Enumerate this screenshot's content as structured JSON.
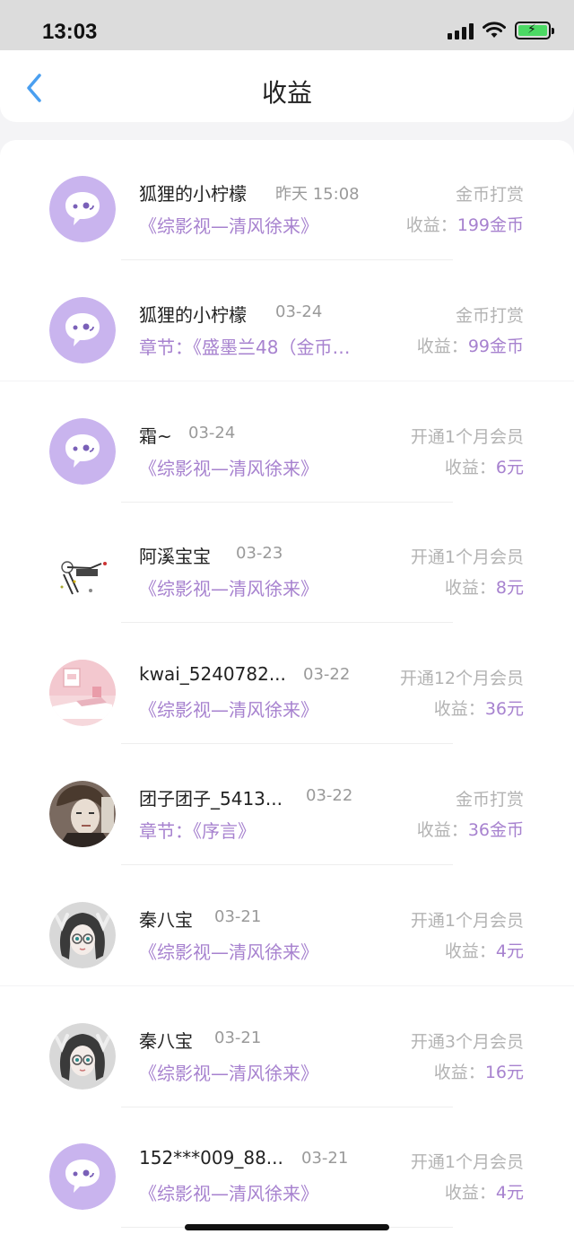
{
  "status": {
    "time": "13:03"
  },
  "nav": {
    "title": "收益"
  },
  "colors": {
    "accent": "#a782cf",
    "avatar_bg": "#c9b4ee",
    "back": "#4a9ff0"
  },
  "entries": [
    {
      "name": "狐狸的小柠檬",
      "date": "昨天 15:08",
      "book": "《综影视—清风徐来》",
      "type": "金币打赏",
      "income_label": "收益：",
      "income_value": "199金币",
      "avatar": "default-chat-avatar"
    },
    {
      "name": "狐狸的小柠檬",
      "date": "03-24",
      "book": "章节：《盛墨兰48（金币…",
      "type": "金币打赏",
      "income_label": "收益：",
      "income_value": "99金币",
      "avatar": "default-chat-avatar"
    },
    {
      "name": "霜~",
      "date": "03-24",
      "book": "《综影视—清风徐来》",
      "type": "开通1个月会员",
      "income_label": "收益：",
      "income_value": "6元",
      "avatar": "default-chat-avatar"
    },
    {
      "name": "阿溪宝宝",
      "date": "03-23",
      "book": "《综影视—清风徐来》",
      "type": "开通1个月会员",
      "income_label": "收益：",
      "income_value": "8元",
      "avatar": "sketch-avatar"
    },
    {
      "name": "kwai_5240782...",
      "date": "03-22",
      "book": "《综影视—清风徐来》",
      "type": "开通12个月会员",
      "income_label": "收益：",
      "income_value": "36元",
      "avatar": "pink-room-avatar"
    },
    {
      "name": "团子团子_5413...",
      "date": "03-22",
      "book": "章节：《序言》",
      "type": "金币打赏",
      "income_label": "收益：",
      "income_value": "36金币",
      "avatar": "portrait-avatar"
    },
    {
      "name": "秦八宝",
      "date": "03-21",
      "book": "《综影视—清风徐来》",
      "type": "开通1个月会员",
      "income_label": "收益：",
      "income_value": "4元",
      "avatar": "anime-girl-avatar"
    },
    {
      "name": "秦八宝",
      "date": "03-21",
      "book": "《综影视—清风徐来》",
      "type": "开通3个月会员",
      "income_label": "收益：",
      "income_value": "16元",
      "avatar": "anime-girl-avatar"
    },
    {
      "name": "152***009_88...",
      "date": "03-21",
      "book": "《综影视—清风徐来》",
      "type": "开通1个月会员",
      "income_label": "收益：",
      "income_value": "4元",
      "avatar": "default-chat-avatar"
    }
  ]
}
